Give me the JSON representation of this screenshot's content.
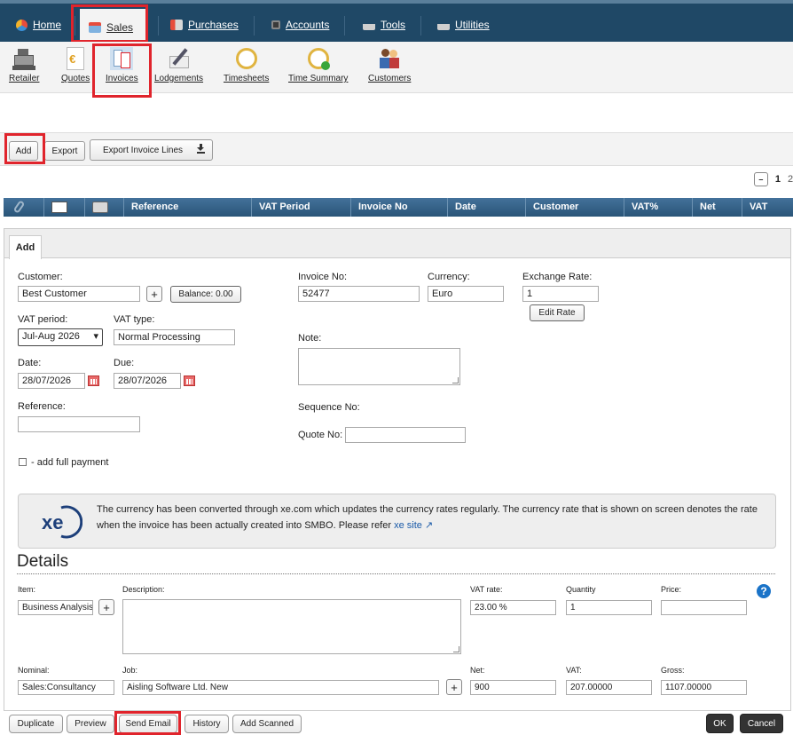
{
  "nav": {
    "tabs": [
      {
        "label": "Home"
      },
      {
        "label": "Sales"
      },
      {
        "label": "Purchases"
      },
      {
        "label": "Accounts"
      },
      {
        "label": "Tools"
      },
      {
        "label": "Utilities"
      }
    ]
  },
  "ribbon": {
    "items": [
      {
        "label": "Retailer"
      },
      {
        "label": "Quotes"
      },
      {
        "label": "Invoices"
      },
      {
        "label": "Lodgements"
      },
      {
        "label": "Timesheets"
      },
      {
        "label": "Time Summary"
      },
      {
        "label": "Customers"
      }
    ]
  },
  "toolbar": {
    "add": "Add",
    "export": "Export",
    "export_lines": "Export Invoice Lines"
  },
  "pager": {
    "current": "1",
    "next": "2",
    "collapse": "–"
  },
  "grid": {
    "columns": [
      "Reference",
      "VAT Period",
      "Invoice No",
      "Date",
      "Customer",
      "VAT%",
      "Net",
      "VAT"
    ]
  },
  "form": {
    "tab": "Add",
    "customer_label": "Customer:",
    "customer": "Best Customer",
    "balance": "Balance: 0.00",
    "invoice_no_label": "Invoice No:",
    "invoice_no": "52477",
    "currency_label": "Currency:",
    "currency": "Euro",
    "exchange_rate_label": "Exchange Rate:",
    "exchange_rate": "1",
    "edit_rate": "Edit Rate",
    "vat_period_label": "VAT period:",
    "vat_period": "Jul-Aug 2026",
    "vat_type_label": "VAT type:",
    "vat_type": "Normal Processing",
    "note_label": "Note:",
    "date_label": "Date:",
    "date": "28/07/2026",
    "due_label": "Due:",
    "due": "28/07/2026",
    "reference_label": "Reference:",
    "sequence_label": "Sequence No:",
    "quote_label": "Quote No:",
    "full_payment_label": "- add full payment"
  },
  "info": {
    "logo": "xe",
    "text": "The currency has been converted through xe.com which updates the currency rates regularly. The currency rate that is shown on screen denotes the rate when the invoice has been actually created into SMBO. Please refer",
    "link": "xe site"
  },
  "details": {
    "title": "Details",
    "item_label": "Item:",
    "item": "Business Analysis",
    "description_label": "Description:",
    "vat_rate_label": "VAT rate:",
    "vat_rate": "23.00 %",
    "quantity_label": "Quantity",
    "quantity": "1",
    "price_label": "Price:",
    "price": "",
    "nominal_label": "Nominal:",
    "nominal": "Sales:Consultancy",
    "job_label": "Job:",
    "job": "Aisling Software Ltd. New",
    "net_label": "Net:",
    "net": "900",
    "vat_label": "VAT:",
    "vat": "207.00000",
    "gross_label": "Gross:",
    "gross": "1107.00000",
    "help": "?"
  },
  "actions": {
    "duplicate": "Duplicate",
    "preview": "Preview",
    "send_email": "Send Email",
    "history": "History",
    "add_scanned": "Add Scanned",
    "ok": "OK",
    "cancel": "Cancel"
  },
  "colors": {
    "nav_bg": "#1f4866",
    "grid_header": "#2f5d84",
    "highlight": "#e0242c",
    "link": "#1a5aa8"
  }
}
